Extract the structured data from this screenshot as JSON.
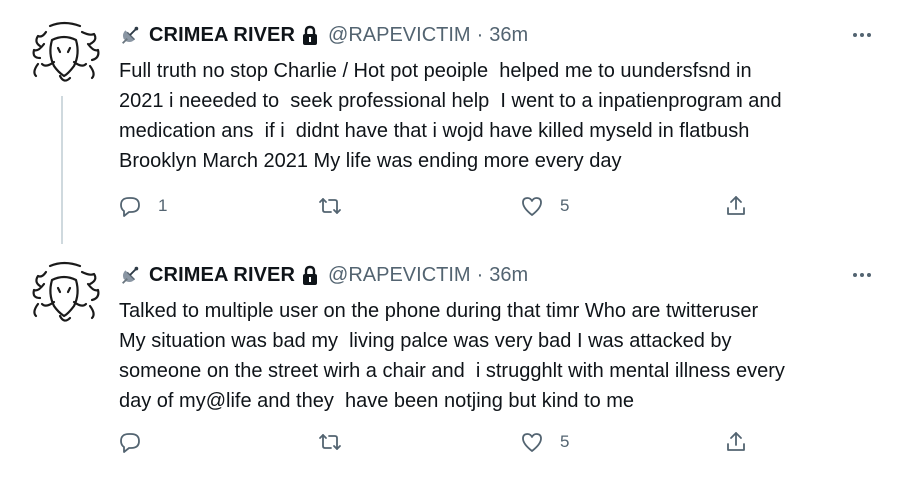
{
  "tweets": [
    {
      "author": {
        "name": "CRIMEA RIVER",
        "handle": "@RAPEVICTIM",
        "avatar_icon": "buffalo-skull-sketch-icon",
        "verified_icon": "satellite-dish-icon",
        "protected_icon": "lock-icon"
      },
      "separator": "·",
      "time": "36m",
      "text": "Full truth no stop Charlie / Hot pot peoiple  helped me to uundersfsnd in\n2021 i neeeded to  seek professional help  I went to a inpatienprogram and\nmedication ans  if i  didnt have that i wojd have killed myseld in flatbush\nBrooklyn March 2021 My life was ending more every day",
      "reply_count": "1",
      "retweet_count": "",
      "like_count": "5"
    },
    {
      "author": {
        "name": "CRIMEA RIVER",
        "handle": "@RAPEVICTIM",
        "avatar_icon": "buffalo-skull-sketch-icon",
        "verified_icon": "satellite-dish-icon",
        "protected_icon": "lock-icon"
      },
      "separator": "·",
      "time": "36m",
      "text": "Talked to multiple user on the phone during that timr Who are twitteruser\nMy situation was bad my  living palce was very bad I was attacked by\nsomeone on the street wirh a chair and  i strugghlt with mental illness every\nday of my@life and they  have been notjing but kind to me",
      "reply_count": "",
      "retweet_count": "",
      "like_count": "5"
    }
  ],
  "colors": {
    "text": "#0f1419",
    "secondary": "#536471",
    "thread_line": "#cfd9de",
    "icon": "#536471"
  }
}
